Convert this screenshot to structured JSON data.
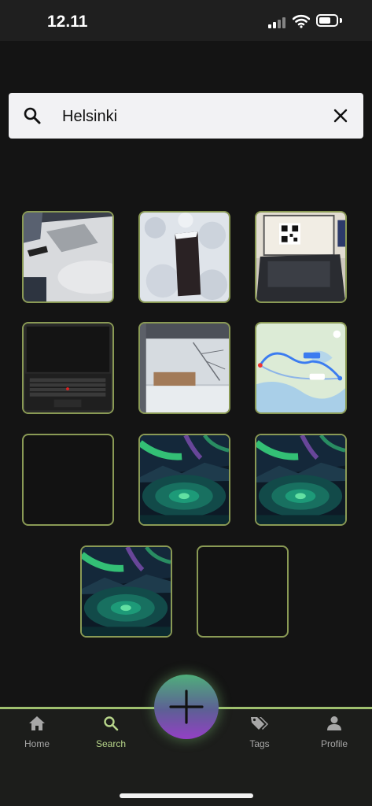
{
  "status_bar": {
    "time": "12.11",
    "battery_level": 0.55
  },
  "search": {
    "query": "Helsinki",
    "icon": "search-icon",
    "clear_icon": "close-icon"
  },
  "results": [
    {
      "content": "laptop-on-desk"
    },
    {
      "content": "dark-object-in-snow"
    },
    {
      "content": "laptop-with-qr-code"
    },
    {
      "content": "black-laptop-keyboard"
    },
    {
      "content": "snowy-window-view"
    },
    {
      "content": "map-route"
    },
    {
      "content": "empty"
    },
    {
      "content": "aurora-landscape"
    },
    {
      "content": "aurora-landscape"
    },
    {
      "content": "aurora-landscape"
    },
    {
      "content": "empty"
    }
  ],
  "nav": {
    "items": [
      {
        "label": "Home",
        "icon": "home-icon",
        "active": false
      },
      {
        "label": "Search",
        "icon": "search-icon",
        "active": true
      },
      {
        "label": "Tags",
        "icon": "tags-icon",
        "active": false
      },
      {
        "label": "Profile",
        "icon": "profile-icon",
        "active": false
      }
    ],
    "fab_icon": "plus-icon"
  },
  "colors": {
    "accent": "#b7d58a",
    "tile_border": "#8a9a55",
    "background": "#141414"
  }
}
